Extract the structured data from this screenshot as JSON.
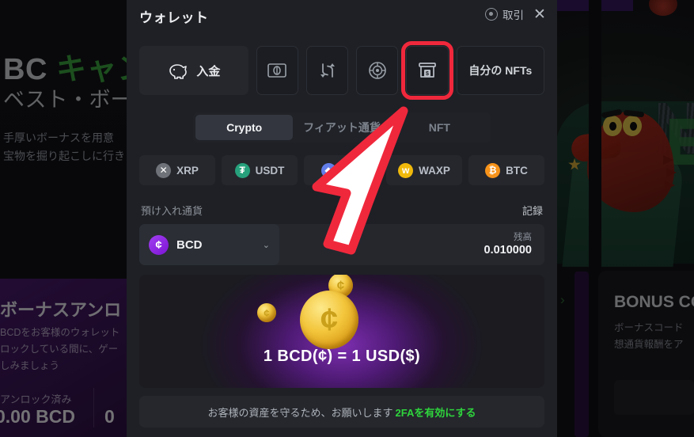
{
  "background": {
    "hero_title_prefix": "BC ",
    "hero_title_green": "キャン",
    "hero_subtitle": "ベスト・ボー",
    "hero_desc_line1": "手厚いボーナスを用意",
    "hero_desc_line2": "宝物を掘り起こしに行き",
    "bonus_card": {
      "title": "ボーナスアンロ",
      "desc_line1": "BCDをお客様のウォレット",
      "desc_line2": "ロックしている間に、ゲー",
      "desc_line3": "しみましょう",
      "stat_label": "アンロック済み",
      "stat_value": "0.00 BCD",
      "stat_value2": "0"
    },
    "bonus_code_card": {
      "title": "BONUS CO",
      "desc_line1": "ボーナスコード",
      "desc_line2": "想通貨報酬をア"
    },
    "carousel_arrow": "›"
  },
  "modal": {
    "title": "ウォレット",
    "trade_label": "取引",
    "close_label": "✕",
    "actions": {
      "deposit_label": "入金",
      "icon_buttons": [
        {
          "name": "banknote-icon",
          "highlighted": false
        },
        {
          "name": "swap-icon",
          "highlighted": false
        },
        {
          "name": "wheel-icon",
          "highlighted": false
        },
        {
          "name": "cashier-icon",
          "highlighted": true
        }
      ],
      "nfts_label": "自分の NFTs"
    },
    "tabs": [
      {
        "label": "Crypto",
        "active": true
      },
      {
        "label": "フィアット通貨",
        "active": false
      },
      {
        "label": "NFT",
        "active": false
      }
    ],
    "coins": [
      {
        "symbol": "XRP",
        "glyph": "✕",
        "color": "#6f7379"
      },
      {
        "symbol": "USDT",
        "glyph": "₮",
        "color": "#26a17b"
      },
      {
        "symbol": "ETH",
        "glyph": "◆",
        "color": "#627eea"
      },
      {
        "symbol": "WAXP",
        "glyph": "w",
        "color": "#f0b90b"
      },
      {
        "symbol": "BTC",
        "glyph": "₿",
        "color": "#f7931a"
      }
    ],
    "currency": {
      "section_label": "預け入れ通貨",
      "record_label": "記録",
      "selected_code": "BCD",
      "selected_glyph": "¢",
      "chevron": "⌄",
      "balance_label": "残高",
      "balance_value": "0.010000"
    },
    "promo": {
      "text": "1 BCD(¢) = 1 USD($)",
      "coin_glyph": "¢"
    },
    "notice": {
      "text": "お客様の資産を守るため、お願いします",
      "link_text": "2FAを有効にする"
    }
  },
  "colors": {
    "modal_bg": "#1e2025",
    "highlight": "#f0283c",
    "accent_green": "#2fd43c",
    "bcd_purple": "#8d1fe0"
  }
}
